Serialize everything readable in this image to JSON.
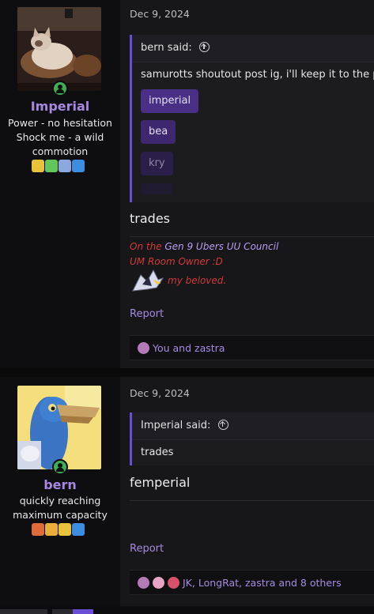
{
  "posts": [
    {
      "username": "Imperial",
      "user_title": "Power - no hesitation Shock me - a wild commotion",
      "date": "Dec 9, 2024",
      "quote": {
        "author_label": "bern said:",
        "text": "samurotts shoutout post ig, i'll keep it to the pe",
        "chips": [
          "imperial",
          "bea",
          "kry"
        ]
      },
      "message": "trades",
      "signature": {
        "line1_prefix": "On the ",
        "line1_link": "Gen 9 Ubers UU Council",
        "line2": "UM Room Owner :D",
        "line3": "my beloved."
      },
      "report_label": "Report",
      "reactions_text": "You and zastra"
    },
    {
      "username": "bern",
      "user_title": "quickly reaching maximum capacity",
      "date": "Dec 9, 2024",
      "quote": {
        "author_label": "Imperial said:",
        "text": "trades"
      },
      "message": "femperial",
      "report_label": "Report",
      "reactions_text": "JK, LongRat, zastra and 8 others"
    }
  ],
  "colors": {
    "accent_purple": "#a787e0",
    "quote_border": "#6a4fd6",
    "signature_red": "#cf3a3a",
    "online_green": "#3fae56"
  }
}
